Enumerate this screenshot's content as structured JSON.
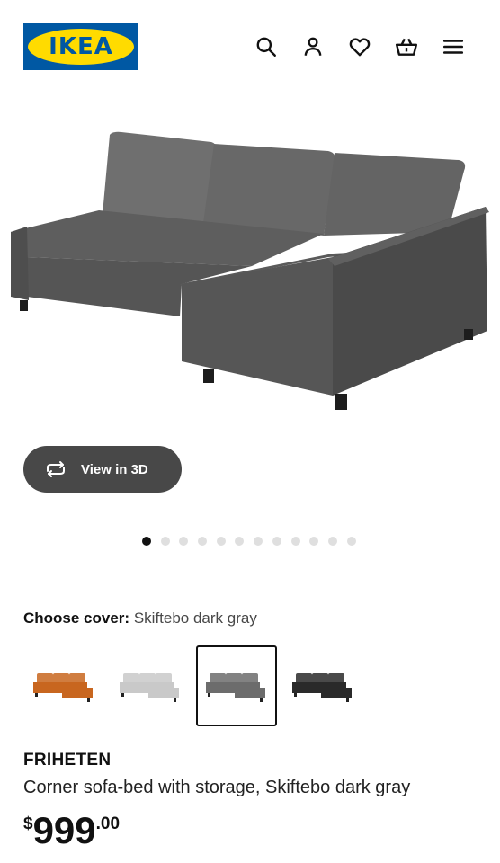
{
  "header": {
    "logo_text": "IKEA",
    "icons": [
      "search-icon",
      "user-icon",
      "heart-icon",
      "basket-icon",
      "menu-icon"
    ]
  },
  "colors": {
    "brand_blue": "#0058a3",
    "brand_yellow": "#ffdb00",
    "button_dark": "#484848"
  },
  "gallery": {
    "view3d_label": "View in 3D",
    "dot_count": 12,
    "active_dot": 0
  },
  "cover": {
    "label": "Choose cover:",
    "value": "Skiftebo dark gray",
    "options": [
      {
        "name": "orange-brown",
        "color": "#c8661f",
        "selected": false
      },
      {
        "name": "light-gray",
        "color": "#c9c9c9",
        "selected": false
      },
      {
        "name": "dark-gray",
        "color": "#6c6c6c",
        "selected": true
      },
      {
        "name": "black",
        "color": "#2a2a2a",
        "selected": false
      }
    ]
  },
  "product": {
    "name": "FRIHETEN",
    "description": "Corner sofa-bed with storage, Skiftebo dark gray",
    "price_currency": "$",
    "price_int": "999",
    "price_dec": ".00"
  }
}
